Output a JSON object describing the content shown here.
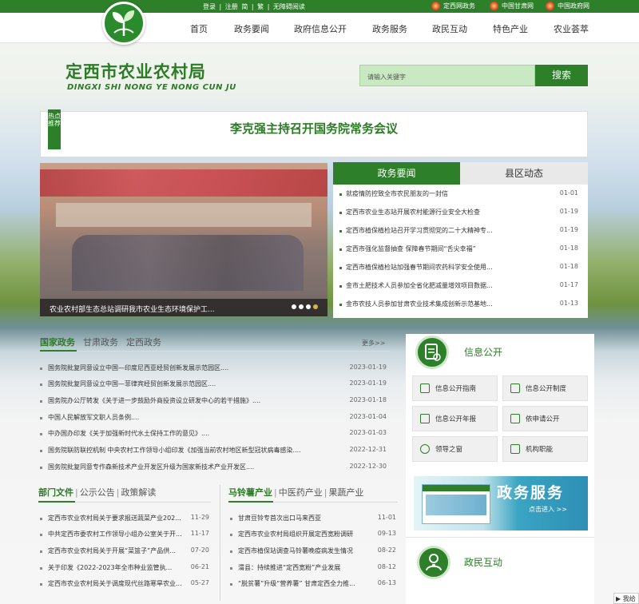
{
  "topbar": {
    "links": [
      "登录",
      "|",
      "注册",
      "简",
      "|",
      "繁",
      "|",
      "无障碍阅读"
    ],
    "gov_links": [
      "定西网政务",
      "中国甘肃网",
      "中国政府网"
    ]
  },
  "nav": {
    "items": [
      "首页",
      "政务要闻",
      "政府信息公开",
      "政务服务",
      "政民互动",
      "特色产业",
      "农业荟萃"
    ]
  },
  "header": {
    "title": "定西市农业农村局",
    "subtitle": "DINGXI SHI NONG YE NONG CUN JU",
    "search_placeholder": "请输入关键字",
    "search_button": "搜索"
  },
  "headline": {
    "tag": "热点推荐",
    "title": "李克强主持召开国务院常务会议"
  },
  "slider": {
    "caption": "农业农村部生态总站调研我市农业生态环境保护工..."
  },
  "news": {
    "tabs": [
      "政务要闻",
      "县区动态"
    ],
    "items": [
      {
        "title": "就疫情防控致全市农民朋友的一封信",
        "date": "01-01"
      },
      {
        "title": "定西市农业生态站开展农村能源行业安全大检查",
        "date": "01-19"
      },
      {
        "title": "定西市植保植检站召开学习贯彻党的二十大精神专...",
        "date": "01-19"
      },
      {
        "title": "定西市强化监督抽查 保障春节期间“舌尖幸福”",
        "date": "01-18"
      },
      {
        "title": "定西市植保植检站加强春节期间农药科学安全使用...",
        "date": "01-18"
      },
      {
        "title": "金市土肥技术人员参加全省化肥减量增效项目数据...",
        "date": "01-17"
      },
      {
        "title": "金市农技人员参加甘肃农业技术集成创新示范基地...",
        "date": "01-13"
      }
    ]
  },
  "policy": {
    "tabs": [
      "国家政务",
      "甘肃政务",
      "定西政务"
    ],
    "more": "更多>>",
    "items": [
      {
        "title": "国务院批复同意设立中国—印度尼西亚经贸创新发展示范园区....",
        "date": "2023-01-19"
      },
      {
        "title": "国务院批复同意设立中国—菲律宾经贸创新发展示范园区....",
        "date": "2023-01-19"
      },
      {
        "title": "国务院办公厅转发《关于进一步鼓励外商投资设立研发中心的若干措施》....",
        "date": "2023-01-18"
      },
      {
        "title": "中国人民解放军文职人员条例....",
        "date": "2023-01-04"
      },
      {
        "title": "中办国办印发《关于加强新时代水土保持工作的意见》....",
        "date": "2023-01-03"
      },
      {
        "title": "国务院联防联控机制 中央农村工作领导小组印发《加强当前农村地区新型冠状病毒感染....",
        "date": "2022-12-31"
      },
      {
        "title": "国务院批复同意专作森新技术产业开发区升级为国家新技术产业开发区....",
        "date": "2022-12-30"
      }
    ]
  },
  "dept": {
    "tabs": [
      "部门文件",
      "公示公告",
      "政策解读"
    ],
    "items": [
      {
        "title": "定西市农业农村局关于要求报送蔬菜产业202...",
        "date": "11-29"
      },
      {
        "title": "中共定西市委农村工作领导小组办公室关于开...",
        "date": "11-17"
      },
      {
        "title": "定西市农业农村局关于开展“菜篮子”产品供...",
        "date": "07-20"
      },
      {
        "title": "关于印发《2022-2023年全市种业监管执...",
        "date": "06-21"
      },
      {
        "title": "定西市农业农村局关于调度现代丝路寒旱农业...",
        "date": "05-27"
      }
    ]
  },
  "industry": {
    "tabs": [
      "马铃薯产业",
      "中医药产业",
      "果蔬产业"
    ],
    "items": [
      {
        "title": "甘肃豆铃专首次出口马来西亚",
        "date": "11-01"
      },
      {
        "title": "定西市农业农村局组织开展定西宽粉调研",
        "date": "09-13"
      },
      {
        "title": "定西市植保站调查马铃薯晚疫病发生情况",
        "date": "08-22"
      },
      {
        "title": "渭县：持续推进“定西宽粉”产业发展",
        "date": "08-12"
      },
      {
        "title": "“脱贫薯”升级“营养薯” 甘肃定西全力推...",
        "date": "06-13"
      }
    ]
  },
  "info_open": {
    "title": "信息公开",
    "buttons": [
      "信息公开指南",
      "信息公开制度",
      "信息公开年报",
      "依申请公开",
      "领导之窗",
      "机构职能"
    ]
  },
  "service": {
    "title": "政务服务",
    "sub": "点击进入 >>"
  },
  "interact": {
    "title": "政民互动"
  },
  "bottom": {
    "label": "▶ 我给"
  }
}
